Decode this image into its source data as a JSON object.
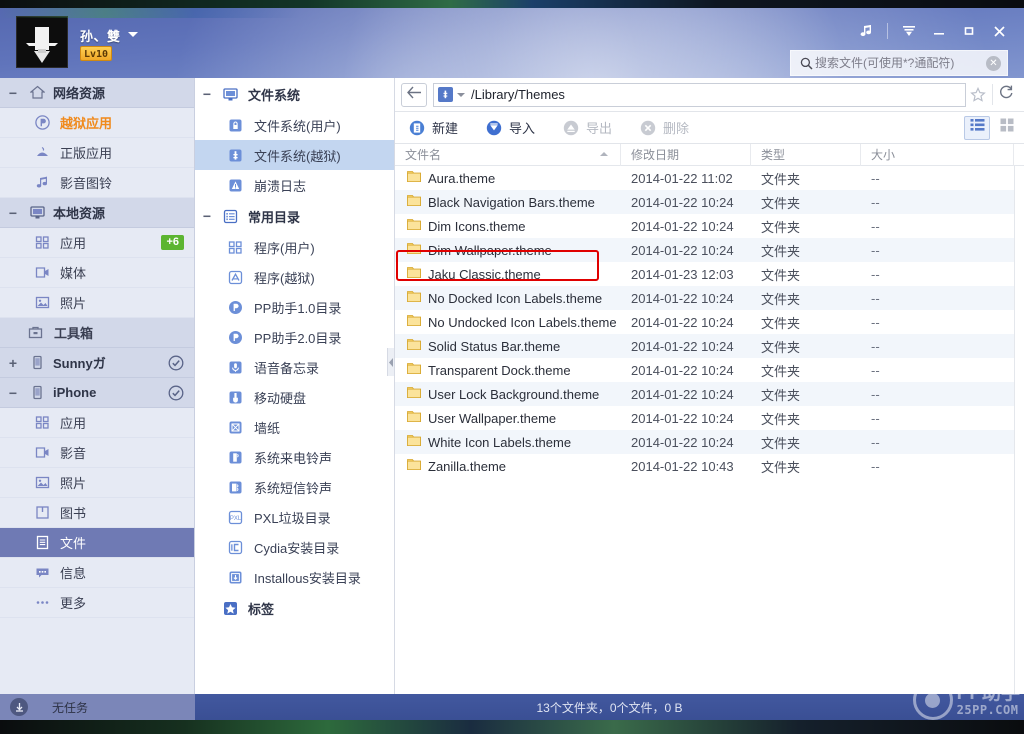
{
  "titlebar": {
    "user_name": "孙、雙",
    "level_badge": "Lv10",
    "avatar_icon": "user-avatar-image",
    "caret_icon": "chevron-down-icon",
    "controls": [
      {
        "name": "music-button",
        "icon": "music-note-icon",
        "glyph": "♫"
      },
      {
        "name": "menu-button",
        "icon": "menu-arrow-icon",
        "glyph": "☰"
      },
      {
        "name": "minimize-button",
        "icon": "minimize-icon",
        "glyph": "–"
      },
      {
        "name": "maximize-button",
        "icon": "maximize-icon",
        "glyph": "□"
      },
      {
        "name": "close-button",
        "icon": "close-icon",
        "glyph": "✕"
      }
    ],
    "search": {
      "placeholder": "搜索文件(可使用*?通配符)",
      "value": "",
      "icon": "search-icon",
      "clear_icon": "clear-icon",
      "clear_glyph": "✕"
    }
  },
  "sidebar": {
    "groups": [
      {
        "label": "网络资源",
        "icon": "home-icon",
        "expander": "−",
        "checked": false,
        "items": [
          {
            "label": "越狱应用",
            "icon": "pp-logo-icon",
            "highlight": true,
            "badge": ""
          },
          {
            "label": "正版应用",
            "icon": "apple-store-icon",
            "highlight": false,
            "badge": ""
          },
          {
            "label": "影音图铃",
            "icon": "music-media-icon",
            "highlight": false,
            "badge": ""
          }
        ]
      },
      {
        "label": "本地资源",
        "icon": "monitor-icon",
        "expander": "−",
        "checked": false,
        "items": [
          {
            "label": "应用",
            "icon": "apps-grid-icon",
            "highlight": false,
            "badge": "+6"
          },
          {
            "label": "媒体",
            "icon": "video-camera-icon",
            "highlight": false,
            "badge": ""
          },
          {
            "label": "照片",
            "icon": "photo-icon",
            "highlight": false,
            "badge": ""
          }
        ]
      }
    ],
    "toolbox": {
      "label": "工具箱",
      "icon": "toolbox-icon"
    },
    "devices": [
      {
        "label": "Sunnyガ",
        "icon": "iphone-device-icon",
        "expander": "+",
        "checked": true,
        "items": []
      },
      {
        "label": "iPhone",
        "icon": "iphone-device-icon",
        "expander": "−",
        "checked": true,
        "items": [
          {
            "label": "应用",
            "icon": "apps-grid-icon",
            "active": false
          },
          {
            "label": "影音",
            "icon": "video-camera-icon",
            "active": false
          },
          {
            "label": "照片",
            "icon": "photo-icon",
            "active": false
          },
          {
            "label": "图书",
            "icon": "book-icon",
            "active": false
          },
          {
            "label": "文件",
            "icon": "document-icon",
            "active": true
          },
          {
            "label": "信息",
            "icon": "message-icon",
            "active": false
          },
          {
            "label": "更多",
            "icon": "more-dots-icon",
            "active": false
          }
        ]
      }
    ]
  },
  "tree": {
    "groups": [
      {
        "label": "文件系统",
        "icon": "monitor-icon",
        "expander": "−",
        "items": [
          {
            "label": "文件系统(用户)",
            "icon": "lock-folder-icon",
            "active": false
          },
          {
            "label": "文件系统(越狱)",
            "icon": "jailbreak-folder-icon",
            "active": true
          },
          {
            "label": "崩溃日志",
            "icon": "warning-log-icon",
            "active": false
          }
        ]
      },
      {
        "label": "常用目录",
        "icon": "list-icon",
        "expander": "−",
        "items": [
          {
            "label": "程序(用户)",
            "icon": "apps-grid-icon",
            "active": false
          },
          {
            "label": "程序(越狱)",
            "icon": "appstore-a-icon",
            "active": false
          },
          {
            "label": "PP助手1.0目录",
            "icon": "pp-logo-icon",
            "active": false
          },
          {
            "label": "PP助手2.0目录",
            "icon": "pp-logo-icon",
            "active": false
          },
          {
            "label": "语音备忘录",
            "icon": "microphone-icon",
            "active": false
          },
          {
            "label": "移动硬盘",
            "icon": "usb-drive-icon",
            "active": false
          },
          {
            "label": "墙纸",
            "icon": "wallpaper-icon",
            "active": false
          },
          {
            "label": "系统来电铃声",
            "icon": "ringtone-icon",
            "active": false
          },
          {
            "label": "系统短信铃声",
            "icon": "sms-tone-icon",
            "active": false
          },
          {
            "label": "PXL垃圾目录",
            "icon": "pxl-icon",
            "active": false
          },
          {
            "label": "Cydia安装目录",
            "icon": "cydia-icon",
            "active": false
          },
          {
            "label": "Installous安装目录",
            "icon": "installous-icon",
            "active": false
          }
        ]
      },
      {
        "label": "标签",
        "icon": "star-icon",
        "expander": "",
        "items": []
      }
    ],
    "collapse_handle_icon": "collapse-left-icon"
  },
  "addressbar": {
    "back_icon": "back-arrow-icon",
    "device_icon": "jailbreak-device-icon",
    "dropdown_icon": "chevron-down-icon",
    "path": "/Library/Themes",
    "star_icon": "favorite-star-icon",
    "star_glyph": "☆",
    "refresh_icon": "refresh-icon",
    "refresh_glyph": "↻"
  },
  "toolbar": {
    "buttons": [
      {
        "label": "新建",
        "icon": "new-folder-icon",
        "disabled": false
      },
      {
        "label": "导入",
        "icon": "import-icon",
        "disabled": false
      },
      {
        "label": "导出",
        "icon": "export-icon",
        "disabled": true
      },
      {
        "label": "删除",
        "icon": "delete-icon",
        "disabled": true
      }
    ],
    "views": [
      {
        "name": "list-view-button",
        "icon": "list-view-icon",
        "active": true
      },
      {
        "name": "grid-view-button",
        "icon": "grid-view-icon",
        "active": false
      }
    ]
  },
  "filetable": {
    "columns": [
      {
        "label": "文件名",
        "sorted": true,
        "sort_dir": "asc"
      },
      {
        "label": "修改日期",
        "sorted": false
      },
      {
        "label": "类型",
        "sorted": false
      },
      {
        "label": "大小",
        "sorted": false
      }
    ],
    "rows": [
      {
        "name": "Aura.theme",
        "date": "2014-01-22 11:02",
        "type": "文件夹",
        "size": "--",
        "icon": "folder-icon"
      },
      {
        "name": "Black Navigation Bars.theme",
        "date": "2014-01-22 10:24",
        "type": "文件夹",
        "size": "--",
        "icon": "folder-icon"
      },
      {
        "name": "Dim Icons.theme",
        "date": "2014-01-22 10:24",
        "type": "文件夹",
        "size": "--",
        "icon": "folder-icon"
      },
      {
        "name": "Dim Wallpaper.theme",
        "date": "2014-01-22 10:24",
        "type": "文件夹",
        "size": "--",
        "icon": "folder-icon"
      },
      {
        "name": "Jaku Classic.theme",
        "date": "2014-01-23 12:03",
        "type": "文件夹",
        "size": "--",
        "icon": "folder-icon"
      },
      {
        "name": "No Docked Icon Labels.theme",
        "date": "2014-01-22 10:24",
        "type": "文件夹",
        "size": "--",
        "icon": "folder-icon"
      },
      {
        "name": "No Undocked Icon Labels.theme",
        "date": "2014-01-22 10:24",
        "type": "文件夹",
        "size": "--",
        "icon": "folder-icon"
      },
      {
        "name": "Solid Status Bar.theme",
        "date": "2014-01-22 10:24",
        "type": "文件夹",
        "size": "--",
        "icon": "folder-icon"
      },
      {
        "name": "Transparent Dock.theme",
        "date": "2014-01-22 10:24",
        "type": "文件夹",
        "size": "--",
        "icon": "folder-icon"
      },
      {
        "name": "User Lock Background.theme",
        "date": "2014-01-22 10:24",
        "type": "文件夹",
        "size": "--",
        "icon": "folder-icon"
      },
      {
        "name": "User Wallpaper.theme",
        "date": "2014-01-22 10:24",
        "type": "文件夹",
        "size": "--",
        "icon": "folder-icon"
      },
      {
        "name": "White Icon Labels.theme",
        "date": "2014-01-22 10:24",
        "type": "文件夹",
        "size": "--",
        "icon": "folder-icon"
      },
      {
        "name": "Zanilla.theme",
        "date": "2014-01-22 10:43",
        "type": "文件夹",
        "size": "--",
        "icon": "folder-icon"
      }
    ],
    "highlighted_row": "Jaku Classic.theme"
  },
  "statusbar": {
    "download_icon": "download-icon",
    "task_text": "无任务",
    "summary": "13个文件夹，0个文件，0 B",
    "watermark_title": "PP助手",
    "watermark_url": "25PP.COM"
  },
  "colors": {
    "accent_blue": "#5579c8",
    "titlebar_blue": "#6074bb",
    "sidebar_bg": "#e6eaf4",
    "sidebar_group_bg": "#d2d8e9",
    "selected_nav": "#6f7ab4",
    "tree_selected": "#c3d6f0",
    "highlight_red": "#e00000",
    "badge_green": "#5cb531",
    "jailbreak_orange": "#f08a1c",
    "statusbar_blue": "#3a4f94",
    "folder_yellow": "#f5c747"
  }
}
